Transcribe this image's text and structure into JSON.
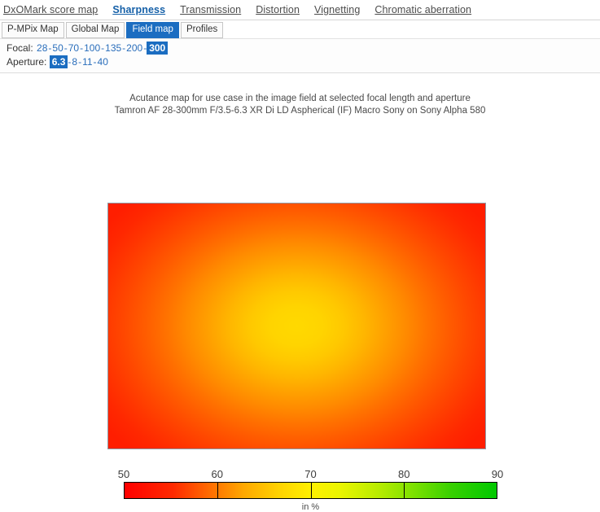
{
  "topnav": {
    "items": [
      {
        "label": "DxOMark score map",
        "active": false
      },
      {
        "label": "Sharpness",
        "active": true
      },
      {
        "label": "Transmission",
        "active": false
      },
      {
        "label": "Distortion",
        "active": false
      },
      {
        "label": "Vignetting",
        "active": false
      },
      {
        "label": "Chromatic aberration",
        "active": false
      }
    ]
  },
  "tabs": {
    "items": [
      {
        "label": "P-MPix Map",
        "selected": false
      },
      {
        "label": "Global Map",
        "selected": false
      },
      {
        "label": "Field map",
        "selected": true
      },
      {
        "label": "Profiles",
        "selected": false
      }
    ]
  },
  "params": {
    "focal": {
      "label": "Focal:",
      "values": [
        "28",
        "50",
        "70",
        "100",
        "135",
        "200",
        "300"
      ],
      "selected": "300"
    },
    "aperture": {
      "label": "Aperture:",
      "values": [
        "6.3",
        "8",
        "11",
        "40"
      ],
      "selected": "6.3"
    },
    "separator": "-"
  },
  "chart_data": {
    "type": "heatmap",
    "title": "Acutance map for use case in the image field at selected focal length and aperture",
    "subtitle": "Tamron AF 28-300mm F/3.5-6.3 XR Di LD Aspherical (IF) Macro Sony on Sony Alpha 580",
    "xlabel": "",
    "ylabel": "",
    "unit_label": "in %",
    "colorbar": {
      "ticks": [
        50,
        60,
        70,
        80,
        90
      ],
      "min": 50,
      "max": 90,
      "stops": [
        "#ff0000",
        "#ffa800",
        "#fff000",
        "#b9ec00",
        "#00c800"
      ],
      "segment_dividers": [
        60,
        70,
        80
      ]
    },
    "description": "Radial acutance field: peak acutance at image centre falling off toward the corners.",
    "grid_rows": 9,
    "grid_cols": 13,
    "values": [
      [
        52,
        53,
        54,
        55,
        56,
        57,
        57,
        57,
        56,
        55,
        54,
        53,
        52
      ],
      [
        53,
        55,
        57,
        59,
        61,
        62,
        63,
        62,
        61,
        59,
        57,
        55,
        53
      ],
      [
        54,
        57,
        60,
        63,
        65,
        67,
        68,
        67,
        65,
        63,
        60,
        57,
        54
      ],
      [
        55,
        58,
        62,
        66,
        69,
        71,
        72,
        71,
        69,
        66,
        62,
        58,
        55
      ],
      [
        55,
        59,
        63,
        67,
        70,
        72,
        73,
        72,
        70,
        67,
        63,
        59,
        55
      ],
      [
        55,
        58,
        62,
        66,
        69,
        71,
        72,
        71,
        69,
        66,
        62,
        58,
        55
      ],
      [
        54,
        57,
        60,
        63,
        65,
        67,
        68,
        67,
        65,
        63,
        60,
        57,
        54
      ],
      [
        53,
        55,
        57,
        59,
        61,
        62,
        63,
        62,
        61,
        59,
        57,
        55,
        53
      ],
      [
        52,
        53,
        54,
        55,
        56,
        57,
        57,
        57,
        56,
        55,
        54,
        53,
        52
      ]
    ],
    "center_value": 73,
    "corner_value": 52
  }
}
